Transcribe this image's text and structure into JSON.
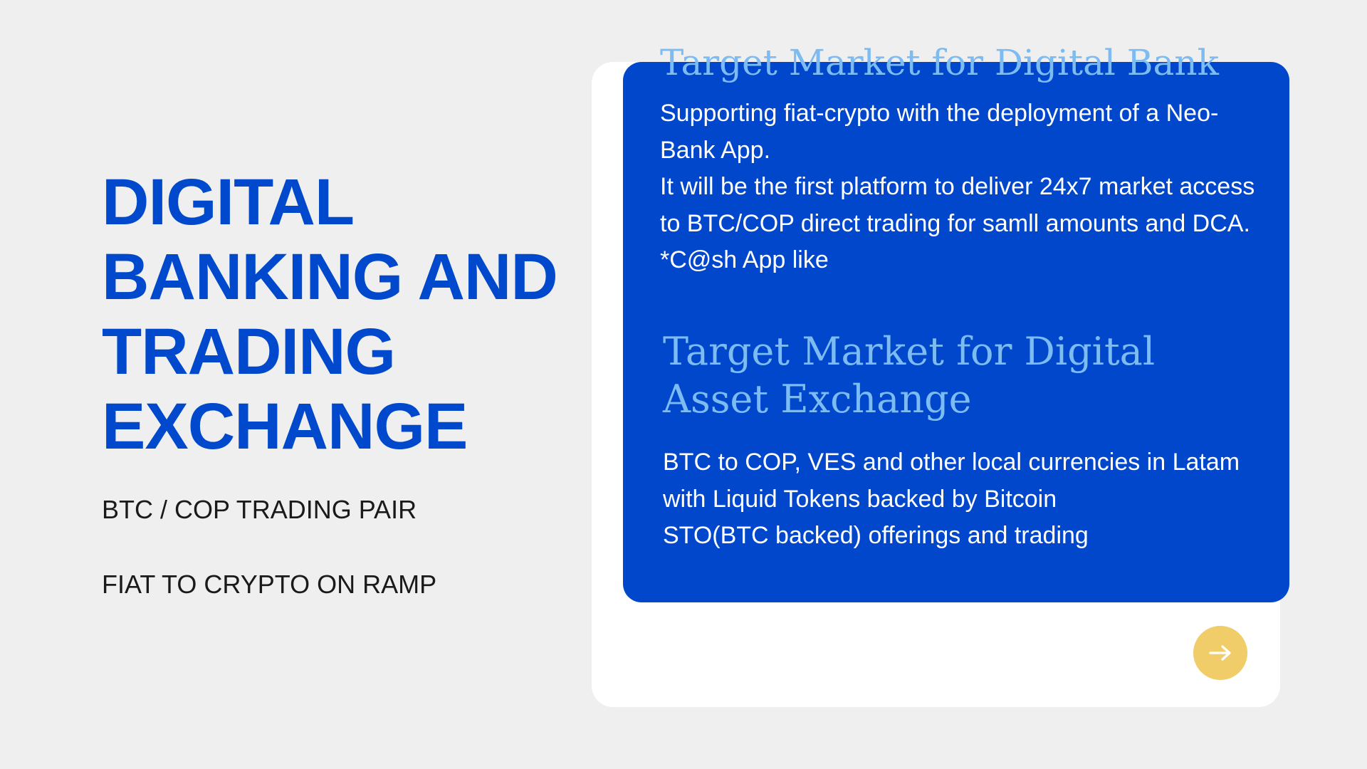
{
  "left": {
    "heading_lines": [
      "DIGITAL",
      "BANKING AND",
      "TRADING",
      "EXCHANGE"
    ],
    "subtitle_1": "BTC / COP TRADING PAIR",
    "subtitle_2": "FIAT TO CRYPTO ON RAMP"
  },
  "card": {
    "section_1": {
      "title": "Target Market for Digital Bank",
      "lines": [
        "Supporting fiat-crypto with the deployment of a Neo-Bank App.",
        "It will be the first platform to deliver 24x7 market access to BTC/COP direct trading for samll amounts and DCA.",
        "*C@sh App like"
      ]
    },
    "section_2": {
      "title": "Target Market for Digital Asset Exchange",
      "lines": [
        "BTC to COP, VES and other local currencies in Latam with Liquid Tokens backed by Bitcoin",
        "STO(BTC backed) offerings and trading"
      ]
    },
    "next_button_icon": "arrow-right-icon"
  },
  "colors": {
    "accent_blue": "#0047cc",
    "title_light_blue": "#7cbcf2",
    "button_yellow": "#f0cd68"
  }
}
